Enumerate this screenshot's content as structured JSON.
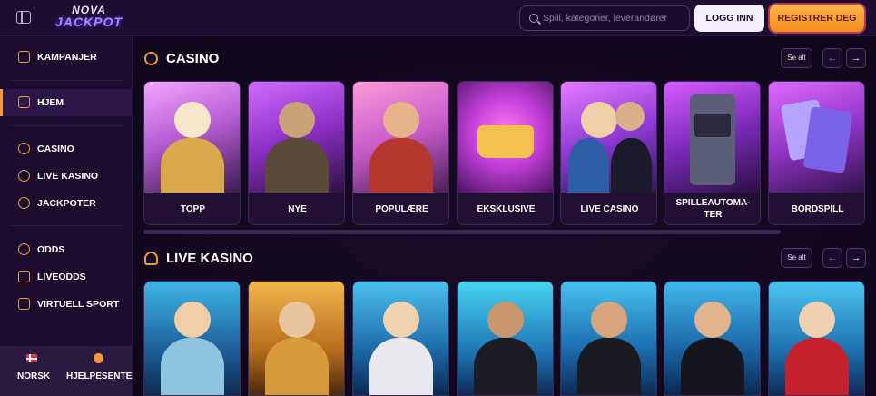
{
  "header": {
    "logo_line1": "NOVA",
    "logo_line2": "JACKPOT",
    "search_placeholder": "Spill, kategorier, leverandører",
    "login_label": "LOGG INN",
    "register_label": "REGISTRER DEG",
    "colors": {
      "register_bg": "#f7a63a",
      "login_bg": "#f4efff"
    }
  },
  "sidebar": {
    "items": [
      {
        "label": "KAMPANJER",
        "icon": "gift-icon"
      },
      {
        "label": "HJEM",
        "icon": "home-icon",
        "active": true
      },
      {
        "label": "CASINO",
        "icon": "casino-chip-icon"
      },
      {
        "label": "LIVE KASINO",
        "icon": "spade-icon"
      },
      {
        "label": "JACKPOTER",
        "icon": "jackpot-icon"
      },
      {
        "label": "ODDS",
        "icon": "soccer-ball-icon"
      },
      {
        "label": "LIVEODDS",
        "icon": "live-play-icon"
      },
      {
        "label": "VIRTUELL SPORT",
        "icon": "gamepad-icon"
      }
    ],
    "bottom": {
      "language_label": "NORSK",
      "help_label": "HJELPESENTER"
    }
  },
  "casino_section": {
    "title": "CASINO",
    "see_all": "Se alt",
    "tiles": [
      {
        "label": "TOPP",
        "theme": "gods"
      },
      {
        "label": "NYE",
        "theme": "adventure"
      },
      {
        "label": "POPULÆRE",
        "theme": "cowboys"
      },
      {
        "label": "EKSKLUSIVE",
        "theme": "crown"
      },
      {
        "label": "LIVE CASINO",
        "theme": "dealers"
      },
      {
        "label": "SPILLEAUTOMA-TER",
        "theme": "slot-machine"
      },
      {
        "label": "BORDSPILL",
        "theme": "cards"
      }
    ]
  },
  "live_section": {
    "title": "LIVE KASINO",
    "see_all": "Se alt",
    "tiles": [
      {
        "theme": "dealer-blue"
      },
      {
        "theme": "dealer-gold"
      },
      {
        "theme": "dealer-blue"
      },
      {
        "theme": "dealer-cyan"
      },
      {
        "theme": "dealer-blue"
      },
      {
        "theme": "dealer-blue"
      },
      {
        "theme": "dealer-red"
      }
    ]
  }
}
